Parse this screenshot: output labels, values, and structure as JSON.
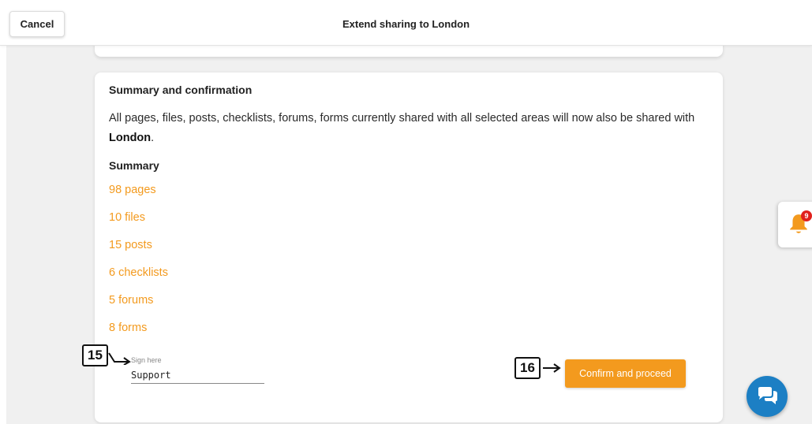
{
  "header": {
    "cancel_label": "Cancel",
    "title": "Extend sharing to London"
  },
  "summary": {
    "heading": "Summary and confirmation",
    "description_before": "All pages, files, posts, checklists, forums, forms currently shared with all selected areas will now also be shared with ",
    "target_area": "London",
    "description_after": ".",
    "list_heading": "Summary",
    "items": [
      {
        "label": "98 pages"
      },
      {
        "label": "10 files"
      },
      {
        "label": "15 posts"
      },
      {
        "label": "6 checklists"
      },
      {
        "label": "5 forums"
      },
      {
        "label": "8 forms"
      }
    ]
  },
  "signature": {
    "label": "Sign here",
    "value": "Support"
  },
  "confirm_label": "Confirm and proceed",
  "annotations": {
    "step_signature": "15",
    "step_confirm": "16"
  },
  "notifications": {
    "count": "9",
    "icon": "bell-icon"
  },
  "chat": {
    "icon": "chat-bubbles-icon"
  },
  "colors": {
    "accent": "#f39a1e",
    "badge_red": "#e0201c",
    "chat_blue": "#1c7fc4"
  }
}
